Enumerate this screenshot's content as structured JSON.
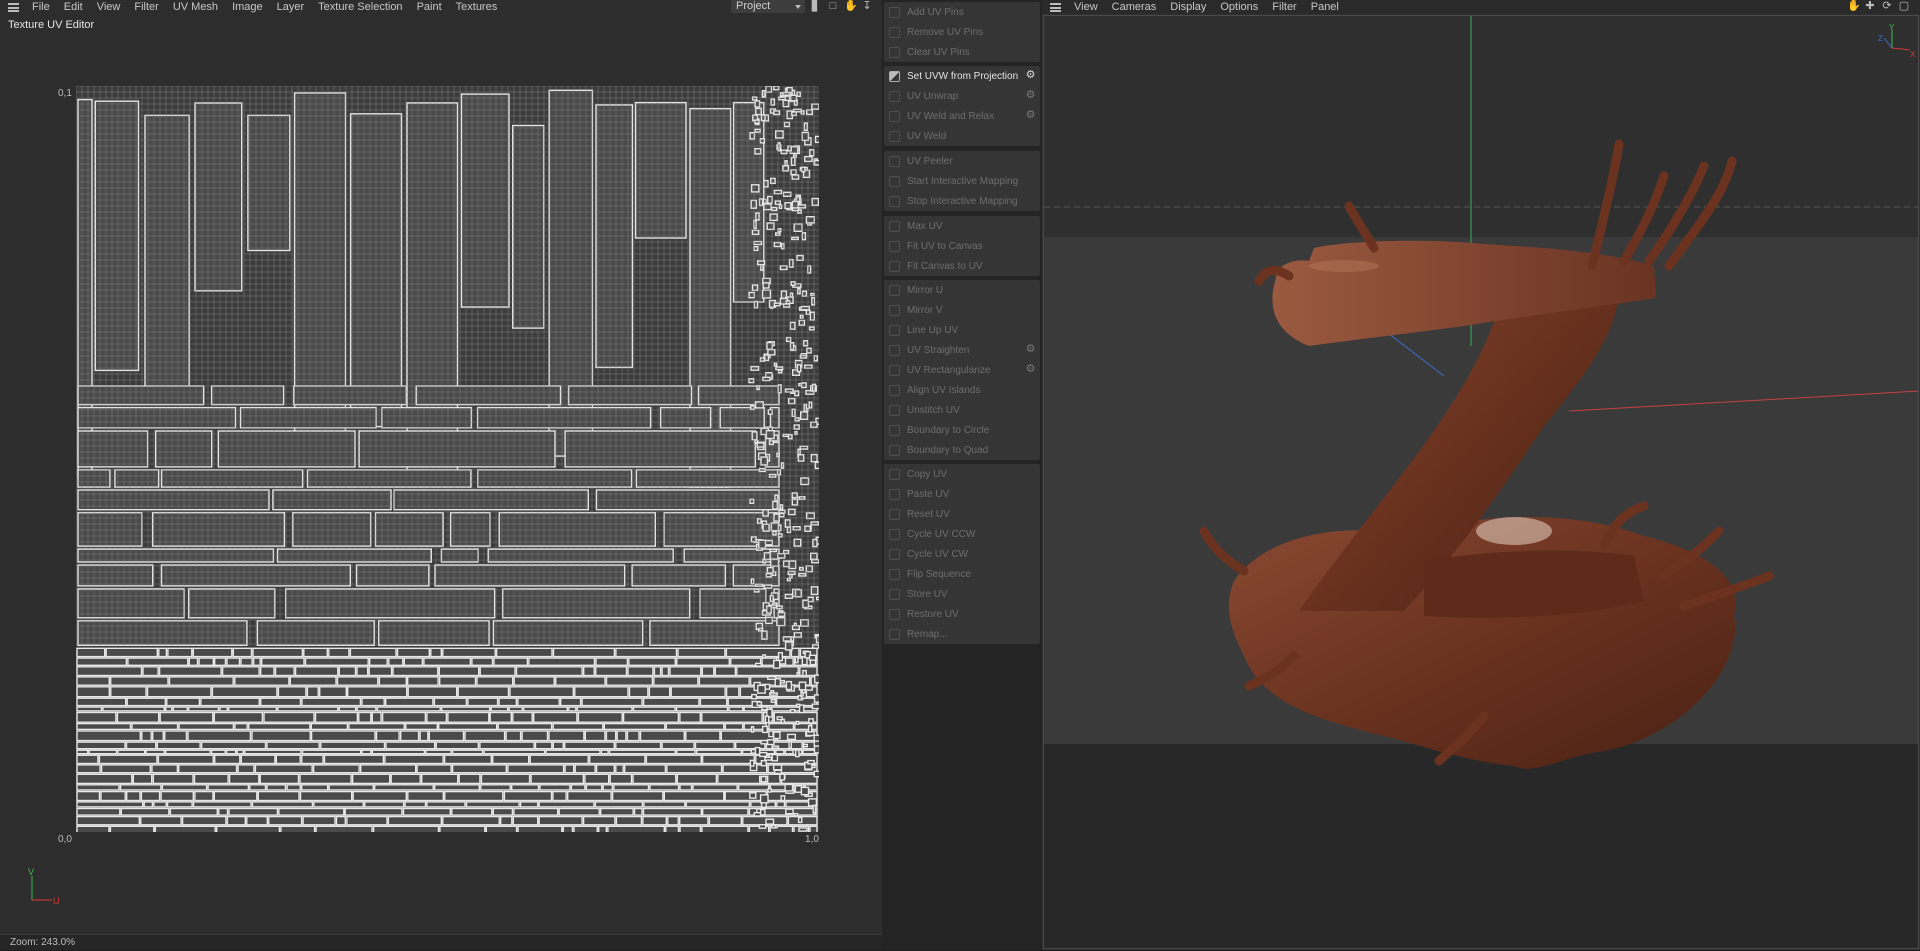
{
  "uv_editor": {
    "menu": [
      "File",
      "Edit",
      "View",
      "Filter",
      "UV Mesh",
      "Image",
      "Layer",
      "Texture Selection",
      "Paint",
      "Textures"
    ],
    "project_dropdown": "Project",
    "title": "Texture UV Editor",
    "axis": {
      "top_left": "0,1",
      "bottom_left": "0,0",
      "bottom_right": "1,0"
    },
    "gizmo": {
      "v": "V",
      "u": "U"
    },
    "zoom": "Zoom: 243.0%"
  },
  "commands": {
    "group1": [
      {
        "label": "Add UV Pins",
        "icon": "pin-icon"
      },
      {
        "label": "Remove UV Pins",
        "icon": "pin-remove-icon"
      },
      {
        "label": "Clear UV Pins",
        "icon": "clear-icon"
      }
    ],
    "group2": [
      {
        "label": "Set UVW from Projection",
        "icon": "projection-icon",
        "active": true,
        "gear": true
      },
      {
        "label": "UV Unwrap",
        "icon": "unwrap-icon",
        "gear": true
      },
      {
        "label": "UV Weld and Relax",
        "icon": "relax-icon",
        "gear": true
      },
      {
        "label": "UV Weld",
        "icon": "weld-icon"
      }
    ],
    "group3": [
      {
        "label": "UV Peeler",
        "icon": "peeler-icon"
      },
      {
        "label": "Start Interactive Mapping",
        "icon": "play-icon"
      },
      {
        "label": "Stop Interactive Mapping",
        "icon": "stop-icon"
      }
    ],
    "group4": [
      {
        "label": "Max UV",
        "icon": "max-icon"
      },
      {
        "label": "Fit UV to Canvas",
        "icon": "fit-icon"
      },
      {
        "label": "Fit Canvas to UV",
        "icon": "fit-canvas-icon"
      }
    ],
    "group5": [
      {
        "label": "Mirror U",
        "icon": "mirror-u-icon"
      },
      {
        "label": "Mirror V",
        "icon": "mirror-v-icon"
      },
      {
        "label": "Line Up UV",
        "icon": "lineup-icon"
      },
      {
        "label": "UV Straighten",
        "icon": "straighten-icon",
        "gear": true
      },
      {
        "label": "UV Rectangularize",
        "icon": "rectangularize-icon",
        "gear": true
      },
      {
        "label": "Align UV Islands",
        "icon": "align-icon"
      },
      {
        "label": "Unstitch UV",
        "icon": "unstitch-icon"
      },
      {
        "label": "Boundary to Circle",
        "icon": "circle-icon"
      },
      {
        "label": "Boundary to Quad",
        "icon": "quad-icon"
      }
    ],
    "group6": [
      {
        "label": "Copy UV",
        "icon": "copy-icon"
      },
      {
        "label": "Paste UV",
        "icon": "paste-icon"
      },
      {
        "label": "Reset UV",
        "icon": "reset-icon"
      },
      {
        "label": "Cycle UV CCW",
        "icon": "ccw-icon"
      },
      {
        "label": "Cycle UV CW",
        "icon": "cw-icon"
      },
      {
        "label": "Flip Sequence",
        "icon": "flip-icon"
      },
      {
        "label": "Store UV",
        "icon": "store-icon"
      },
      {
        "label": "Restore UV",
        "icon": "restore-icon"
      },
      {
        "label": "Remap...",
        "icon": "remap-icon"
      }
    ]
  },
  "viewport": {
    "menu": [
      "View",
      "Cameras",
      "Display",
      "Options",
      "Filter",
      "Panel"
    ],
    "gizmo": {
      "y": "Y",
      "x": "X",
      "z": "Z"
    }
  }
}
